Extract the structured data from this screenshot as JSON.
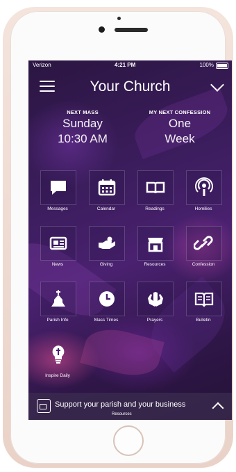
{
  "status_bar": {
    "carrier": "Verizon",
    "time": "4:21 PM",
    "battery": "100%"
  },
  "header": {
    "title": "Your Church"
  },
  "next_mass": {
    "label": "NEXT MASS",
    "value_line1": "Sunday",
    "value_line2": "10:30 AM"
  },
  "next_confession": {
    "label": "MY NEXT CONFESSION",
    "value_line1": "One",
    "value_line2": "Week"
  },
  "grid_items": [
    {
      "label": "Messages",
      "icon": "message-icon"
    },
    {
      "label": "Calendar",
      "icon": "calendar-icon"
    },
    {
      "label": "Readings",
      "icon": "book-icon"
    },
    {
      "label": "Homilies",
      "icon": "podcast-icon"
    },
    {
      "label": "News",
      "icon": "newspaper-icon"
    },
    {
      "label": "Giving",
      "icon": "giving-icon"
    },
    {
      "label": "Resources",
      "icon": "store-icon"
    },
    {
      "label": "Confession",
      "icon": "chain-icon"
    },
    {
      "label": "Parish Info",
      "icon": "church-icon"
    },
    {
      "label": "Mass Times",
      "icon": "clock-icon"
    },
    {
      "label": "Prayers",
      "icon": "praying-hands-icon"
    },
    {
      "label": "Bulletin",
      "icon": "bulletin-icon"
    },
    {
      "label": "Inspire Daily",
      "icon": "lightbulb-cross-icon"
    }
  ],
  "bottom_bar": {
    "text": "Support your parish and your business",
    "sub": "Resources"
  },
  "colors": {
    "accent": "#4a2170",
    "bar": "#3c2d50"
  }
}
